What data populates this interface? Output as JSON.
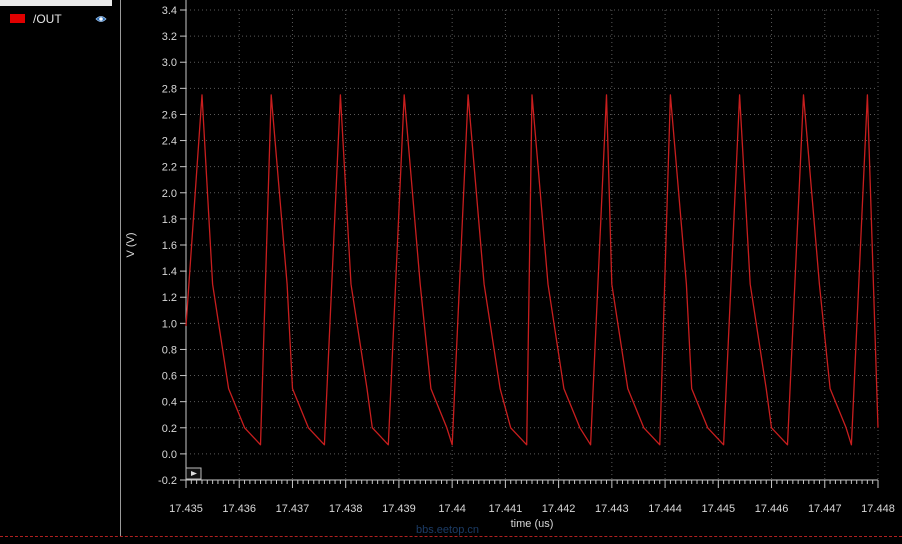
{
  "legend": {
    "items": [
      {
        "label": "/OUT",
        "color": "#e00000",
        "icon": "eye-icon"
      }
    ]
  },
  "watermark": "bbs.eetop.cn",
  "chart_data": {
    "type": "line",
    "xlabel": "time (us)",
    "ylabel": "V (V)",
    "xlim": [
      17.435,
      17.448
    ],
    "ylim": [
      -0.2,
      3.4
    ],
    "xticks": [
      "17.435",
      "17.436",
      "17.437",
      "17.438",
      "17.439",
      "17.44",
      "17.441",
      "17.442",
      "17.443",
      "17.444",
      "17.445",
      "17.446",
      "17.447",
      "17.448"
    ],
    "yticks": [
      "3.4",
      "3.2",
      "3.0",
      "2.8",
      "2.6",
      "2.4",
      "2.2",
      "2.0",
      "1.8",
      "1.6",
      "1.4",
      "1.2",
      "1.0",
      "0.8",
      "0.6",
      "0.4",
      "0.2",
      "0.0",
      "-0.2"
    ],
    "grid": true,
    "colors": {
      "background": "#000000",
      "axis": "#c8c8c8",
      "grid": "#5a5a5a",
      "text": "#d8d8d8",
      "trace": "#c81e1e"
    },
    "series": [
      {
        "name": "/OUT",
        "x": [
          17.435,
          17.4353,
          17.4355,
          17.4358,
          17.4361,
          17.4364,
          17.4366,
          17.4369,
          17.437,
          17.4373,
          17.4376,
          17.4379,
          17.4381,
          17.4384,
          17.4385,
          17.4388,
          17.4391,
          17.4394,
          17.4396,
          17.4399,
          17.44,
          17.4403,
          17.4406,
          17.4409,
          17.4411,
          17.4414,
          17.4415,
          17.4418,
          17.4421,
          17.4424,
          17.4426,
          17.4429,
          17.443,
          17.4433,
          17.4436,
          17.4439,
          17.4441,
          17.4444,
          17.4445,
          17.4448,
          17.4451,
          17.4454,
          17.4456,
          17.4459,
          17.446,
          17.4463,
          17.4466,
          17.4469,
          17.4471,
          17.4474,
          17.4475,
          17.4478,
          17.448
        ],
        "y": [
          0.98,
          2.75,
          1.3,
          0.5,
          0.2,
          0.07,
          2.75,
          1.3,
          0.5,
          0.2,
          0.07,
          2.75,
          1.3,
          0.5,
          0.2,
          0.07,
          2.75,
          1.3,
          0.5,
          0.2,
          0.07,
          2.75,
          1.3,
          0.5,
          0.2,
          0.07,
          2.75,
          1.3,
          0.5,
          0.2,
          0.07,
          2.75,
          1.3,
          0.5,
          0.2,
          0.07,
          2.75,
          1.3,
          0.5,
          0.2,
          0.07,
          2.75,
          1.3,
          0.5,
          0.2,
          0.07,
          2.75,
          1.3,
          0.5,
          0.2,
          0.07,
          2.75,
          0.2
        ]
      }
    ]
  }
}
